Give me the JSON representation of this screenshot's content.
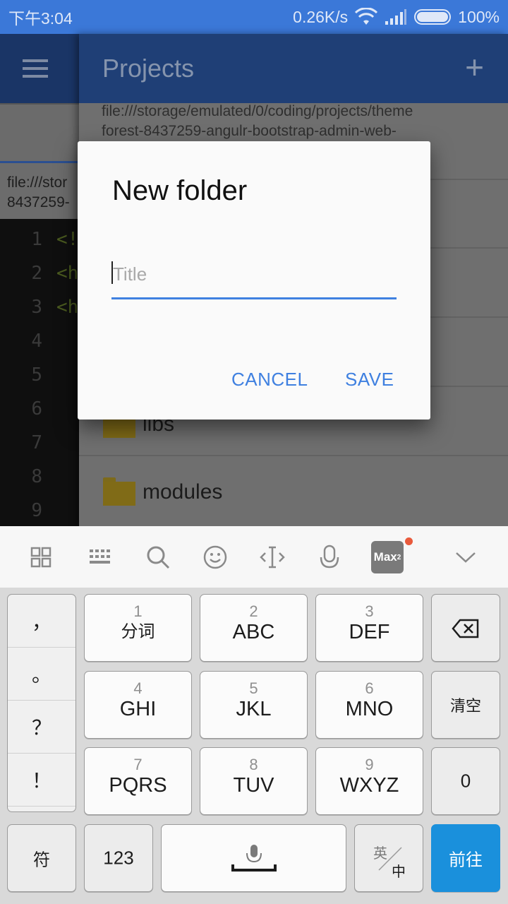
{
  "status_bar": {
    "time": "下午3:04",
    "speed": "0.26K/s",
    "battery": "100%"
  },
  "editor": {
    "path_line1": "file:///stor",
    "path_line2": "8437259-",
    "line_numbers": [
      "1",
      "2",
      "3",
      "4",
      "5",
      "6",
      "7",
      "8",
      "9"
    ],
    "code_fragments": [
      "<!",
      "<h",
      "<h"
    ]
  },
  "drawer": {
    "title": "Projects",
    "add_label": "+",
    "path_line1": "file:///storage/emulated/0/coding/projects/theme",
    "path_line2": "forest-8437259-angulr-bootstrap-admin-web-",
    "folders": [
      "libs",
      "modules"
    ]
  },
  "dialog": {
    "title": "New folder",
    "input_value": "",
    "input_placeholder": "Title",
    "cancel_label": "CANCEL",
    "save_label": "SAVE",
    "accent_color": "#3f80e0"
  },
  "keyboard": {
    "toolbar_icons": [
      "grid-icon",
      "keyboard-icon",
      "search-icon",
      "emoji-icon",
      "cursor-icon",
      "microphone-icon",
      "max-icon",
      "chevron-down-icon"
    ],
    "max_label": "Max",
    "max_superscript": "2",
    "punctuation": [
      "，",
      "。",
      "？",
      "！"
    ],
    "keys_row1": [
      {
        "num": "1",
        "label": "分词"
      },
      {
        "num": "2",
        "label": "ABC"
      },
      {
        "num": "3",
        "label": "DEF"
      }
    ],
    "keys_row2": [
      {
        "num": "4",
        "label": "GHI"
      },
      {
        "num": "5",
        "label": "JKL"
      },
      {
        "num": "6",
        "label": "MNO"
      }
    ],
    "keys_row3": [
      {
        "num": "7",
        "label": "PQRS"
      },
      {
        "num": "8",
        "label": "TUV"
      },
      {
        "num": "9",
        "label": "WXYZ"
      }
    ],
    "clear_label": "清空",
    "zero_label": "0",
    "symbol_label": "符",
    "numeric_label": "123",
    "lang_top": "英",
    "lang_bottom": "中",
    "go_label": "前往",
    "go_color": "#1a90dc"
  }
}
